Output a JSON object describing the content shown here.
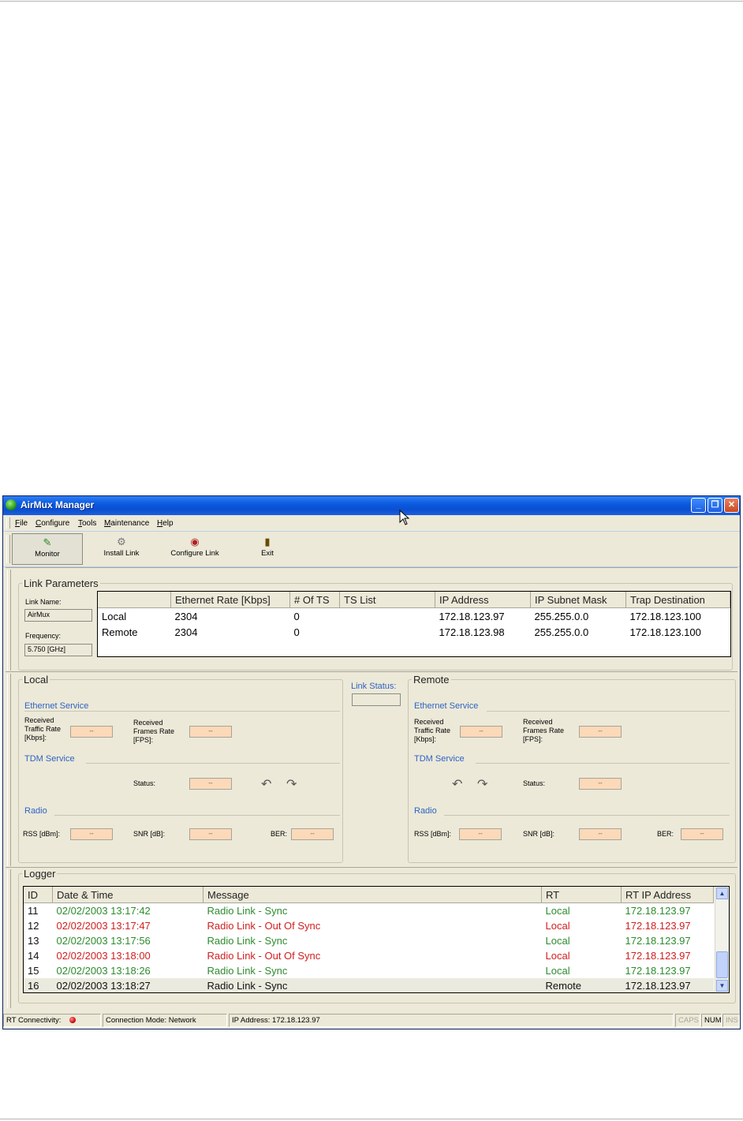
{
  "window": {
    "title": "AirMux Manager"
  },
  "menu": [
    "File",
    "Configure",
    "Tools",
    "Maintenance",
    "Help"
  ],
  "toolbar": [
    {
      "label": "Monitor",
      "icon": "monitor-icon"
    },
    {
      "label": "Install Link",
      "icon": "install-link-icon"
    },
    {
      "label": "Configure Link",
      "icon": "configure-link-icon"
    },
    {
      "label": "Exit",
      "icon": "exit-icon"
    }
  ],
  "link_params": {
    "title": "Link Parameters",
    "link_name_label": "Link Name:",
    "link_name": "AirMux",
    "frequency_label": "Frequency:",
    "frequency": "5.750 [GHz]",
    "columns": [
      "",
      "Ethernet Rate [Kbps]",
      "# Of TS",
      "TS List",
      "IP Address",
      "IP Subnet Mask",
      "Trap Destination"
    ],
    "rows": [
      {
        "name": "Local",
        "eth_rate": "2304",
        "ts": "0",
        "ts_list": "",
        "ip": "172.18.123.97",
        "mask": "255.255.0.0",
        "trap": "172.18.123.100"
      },
      {
        "name": "Remote",
        "eth_rate": "2304",
        "ts": "0",
        "ts_list": "",
        "ip": "172.18.123.98",
        "mask": "255.255.0.0",
        "trap": "172.18.123.100"
      }
    ]
  },
  "link_status": {
    "label": "Link Status:"
  },
  "local": {
    "title": "Local",
    "ethernet_service": "Ethernet Service",
    "traffic_rate_label": [
      "Received",
      "Traffic Rate",
      "[Kbps]:"
    ],
    "traffic_rate": "--",
    "frames_rate_label": [
      "Received",
      "Frames Rate",
      "[FPS]:"
    ],
    "frames_rate": "--",
    "tdm_service": "TDM Service",
    "status_label": "Status:",
    "status": "--",
    "radio": "Radio",
    "rss_label": "RSS [dBm]:",
    "rss": "--",
    "snr_label": "SNR [dB]:",
    "snr": "--",
    "ber_label": "BER:",
    "ber": "--"
  },
  "remote": {
    "title": "Remote",
    "ethernet_service": "Ethernet Service",
    "traffic_rate_label": [
      "Received",
      "Traffic Rate",
      "[Kbps]:"
    ],
    "traffic_rate": "--",
    "frames_rate_label": [
      "Received",
      "Frames Rate",
      "[FPS]:"
    ],
    "frames_rate": "--",
    "tdm_service": "TDM Service",
    "status_label": "Status:",
    "status": "--",
    "radio": "Radio",
    "rss_label": "RSS [dBm]:",
    "rss": "--",
    "snr_label": "SNR [dB]:",
    "snr": "--",
    "ber_label": "BER:",
    "ber": "--"
  },
  "logger": {
    "title": "Logger",
    "columns": [
      "ID",
      "Date & Time",
      "Message",
      "RT",
      "RT IP Address"
    ],
    "rows": [
      {
        "id": "11",
        "time": "02/02/2003 13:17:42",
        "msg": "Radio Link - Sync",
        "rt": "Local",
        "ip": "172.18.123.97",
        "c_time": "g",
        "c_msg": "g",
        "c_rt": "g",
        "c_ip": "g"
      },
      {
        "id": "12",
        "time": "02/02/2003 13:17:47",
        "msg": "Radio Link - Out Of Sync",
        "rt": "Local",
        "ip": "172.18.123.97",
        "c_time": "r",
        "c_msg": "r",
        "c_rt": "r",
        "c_ip": "r"
      },
      {
        "id": "13",
        "time": "02/02/2003 13:17:56",
        "msg": "Radio Link - Sync",
        "rt": "Local",
        "ip": "172.18.123.97",
        "c_time": "g",
        "c_msg": "g",
        "c_rt": "g",
        "c_ip": "g"
      },
      {
        "id": "14",
        "time": "02/02/2003 13:18:00",
        "msg": "Radio Link - Out Of Sync",
        "rt": "Local",
        "ip": "172.18.123.97",
        "c_time": "r",
        "c_msg": "r",
        "c_rt": "r",
        "c_ip": "r"
      },
      {
        "id": "15",
        "time": "02/02/2003 13:18:26",
        "msg": "Radio Link - Sync",
        "rt": "Local",
        "ip": "172.18.123.97",
        "c_time": "g",
        "c_msg": "g",
        "c_rt": "g",
        "c_ip": "g"
      },
      {
        "id": "16",
        "time": "02/02/2003 13:18:27",
        "msg": "Radio Link - Sync",
        "rt": "Remote",
        "ip": "172.18.123.97",
        "c_time": "k",
        "c_msg": "k",
        "c_rt": "k",
        "c_ip": "k"
      }
    ]
  },
  "status_bar": {
    "rt_connectivity": "RT Connectivity:",
    "connection_mode": "Connection Mode: Network",
    "ip_address": "IP Address: 172.18.123.97",
    "caps": "CAPS",
    "num": "NUM",
    "ins": "INS"
  },
  "colors": {
    "title_bar": "#0b4fd0",
    "value_field": "#fcd9b8",
    "link_blue": "#2e63c6",
    "ok_green": "#2e8b2e",
    "error_red": "#d21e1e",
    "led_red": "#c00000"
  }
}
